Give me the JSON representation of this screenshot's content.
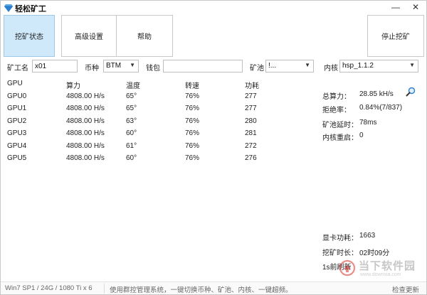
{
  "window": {
    "title": "轻松矿工",
    "minimize": "—",
    "close": "✕"
  },
  "toolbar": {
    "mining_status": "挖矿状态",
    "advanced_settings": "高级设置",
    "help": "帮助",
    "stop_mining": "停止挖矿"
  },
  "form": {
    "worker_label": "矿工名",
    "worker_value": "x01",
    "coin_label": "币种",
    "coin_value": "BTM",
    "wallet_label": "钱包",
    "wallet_value": "",
    "pool_label": "矿池",
    "pool_value": "!...",
    "kernel_label": "内核",
    "kernel_value": "hsp_1.1.2"
  },
  "table": {
    "headers": [
      "GPU",
      "算力",
      "温度",
      "转速",
      "功耗"
    ],
    "rows": [
      [
        "GPU0",
        "4808.00 H/s",
        "65°",
        "76%",
        "277"
      ],
      [
        "GPU1",
        "4808.00 H/s",
        "65°",
        "76%",
        "277"
      ],
      [
        "GPU2",
        "4808.00 H/s",
        "63°",
        "76%",
        "280"
      ],
      [
        "GPU3",
        "4808.00 H/s",
        "60°",
        "76%",
        "281"
      ],
      [
        "GPU4",
        "4808.00 H/s",
        "61°",
        "76%",
        "272"
      ],
      [
        "GPU5",
        "4808.00 H/s",
        "60°",
        "76%",
        "276"
      ]
    ]
  },
  "stats": {
    "total_hashrate_label": "总算力：",
    "total_hashrate_value": "28.85 kH/s",
    "reject_rate_label": "拒绝率：",
    "reject_rate_value": "0.84%(7/837)",
    "pool_latency_label": "矿池延时：",
    "pool_latency_value": "78ms",
    "kernel_restart_label": "内核重启：",
    "kernel_restart_value": "0",
    "card_power_label": "显卡功耗：",
    "card_power_value": "1663",
    "mining_duration_label": "挖矿时长：",
    "mining_duration_value": "02时09分",
    "refresh_text": "1s前刷新"
  },
  "statusbar": {
    "system_info": "Win7 SP1 / 24G / 1080 Ti x 6",
    "promo": "使用群控管理系统，一键切换币种、矿池、内核、一键超频。",
    "update": "检查更新"
  },
  "watermark": {
    "text_cn": "当下软件园",
    "text_en": "www.downxia.com"
  },
  "icons": {
    "app": "diamond-icon",
    "search": "magnifier-icon"
  },
  "colors": {
    "active_tab_bg": "#cfe8fa",
    "app_icon_blue": "#2a7fd4",
    "watermark_red": "#d9322b"
  }
}
